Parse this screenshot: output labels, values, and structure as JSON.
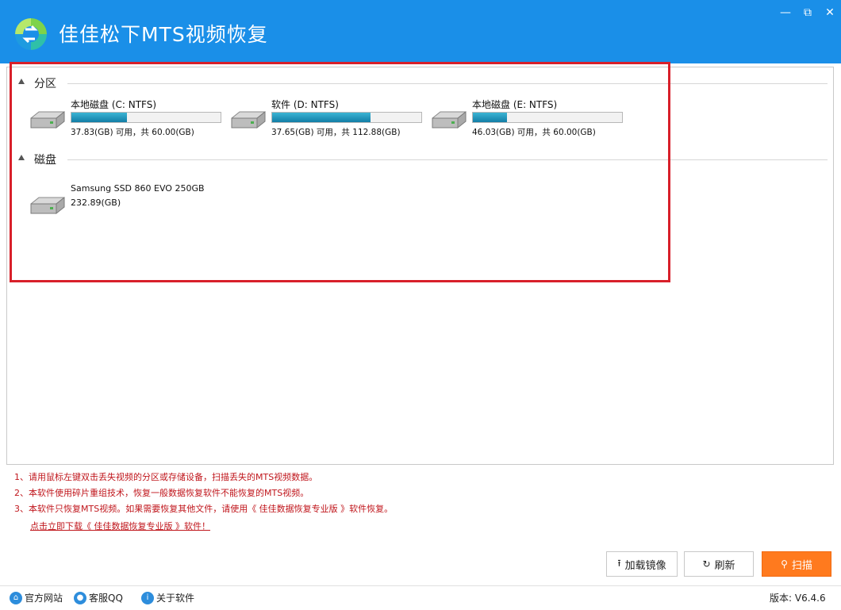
{
  "app": {
    "title": "佳佳松下MTS视频恢复",
    "window_controls": [
      "minimize-icon",
      "maximize-icon",
      "close-icon"
    ]
  },
  "partitions": {
    "label": "分区",
    "items": [
      {
        "name": "本地磁盘 (C: NTFS)",
        "info": "37.83(GB) 可用，共 60.00(GB)",
        "used_fraction": 0.37
      },
      {
        "name": "软件 (D: NTFS)",
        "info": "37.65(GB) 可用，共 112.88(GB)",
        "used_fraction": 0.66
      },
      {
        "name": "本地磁盘 (E: NTFS)",
        "info": "46.03(GB) 可用，共 60.00(GB)",
        "used_fraction": 0.23
      }
    ]
  },
  "disks": {
    "label": "磁盘",
    "items": [
      {
        "name": "Samsung SSD 860 EVO 250GB",
        "size": "232.89(GB)"
      }
    ]
  },
  "notes": [
    "1、请用鼠标左键双击丢失视频的分区或存储设备，扫描丢失的MTS视频数据。",
    "2、本软件使用碎片重组技术，恢复一般数据恢复软件不能恢复的MTS视频。",
    "3、本软件只恢复MTS视频。如果需要恢复其他文件，请使用《 佳佳数据恢复专业版 》软件恢复。"
  ],
  "download_link": "点击立即下载《 佳佳数据恢复专业版 》软件！",
  "buttons": {
    "load_image": "加载镜像",
    "refresh": "刷新",
    "scan": "扫描"
  },
  "status": {
    "official_site": "官方网站",
    "support_qq": "客服QQ",
    "about": "关于软件",
    "version": "版本: V6.4.6"
  },
  "colors": {
    "titlebar": "#1a8fe8",
    "accent_scan": "#ff7a1e",
    "note_red": "#c0161c",
    "highlight": "#d8202a",
    "progress": "#127ea6"
  }
}
